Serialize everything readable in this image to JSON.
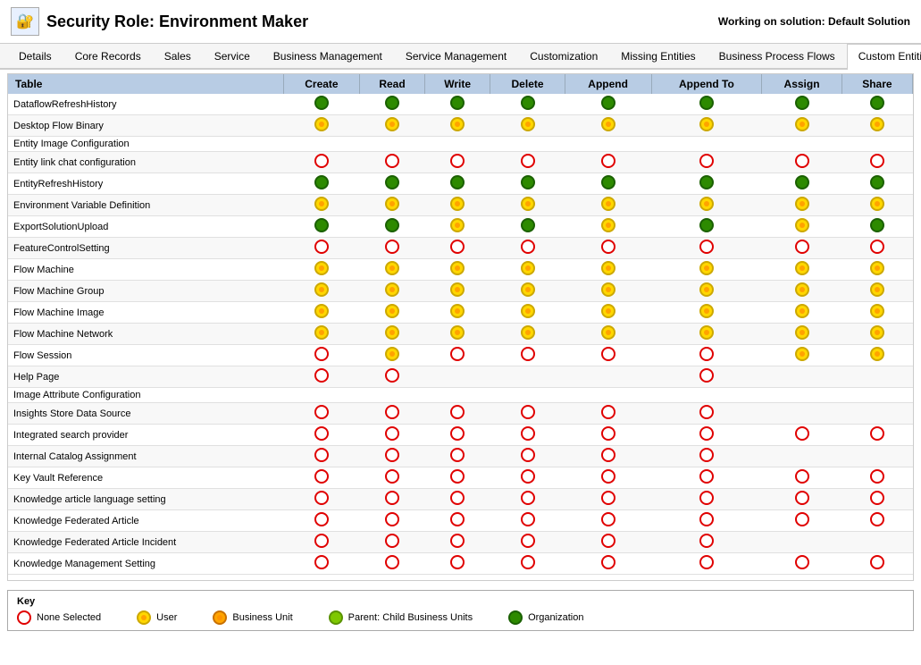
{
  "header": {
    "title": "Security Role: Environment Maker",
    "working_on": "Working on solution: Default Solution",
    "icon": "🔐"
  },
  "tabs": [
    {
      "label": "Details",
      "active": false
    },
    {
      "label": "Core Records",
      "active": false
    },
    {
      "label": "Sales",
      "active": false
    },
    {
      "label": "Service",
      "active": false
    },
    {
      "label": "Business Management",
      "active": false
    },
    {
      "label": "Service Management",
      "active": false
    },
    {
      "label": "Customization",
      "active": false
    },
    {
      "label": "Missing Entities",
      "active": false
    },
    {
      "label": "Business Process Flows",
      "active": false
    },
    {
      "label": "Custom Entities",
      "active": true
    }
  ],
  "table": {
    "columns": [
      "Table",
      "Create",
      "Read",
      "Write",
      "Delete",
      "Append",
      "Append To",
      "Assign",
      "Share"
    ],
    "rows": [
      {
        "name": "DataflowRefreshHistory",
        "create": "green",
        "read": "green",
        "write": "green",
        "delete": "green",
        "append": "green",
        "appendTo": "green",
        "assign": "green",
        "share": "green"
      },
      {
        "name": "Desktop Flow Binary",
        "create": "yellow",
        "read": "yellow",
        "write": "yellow",
        "delete": "yellow",
        "append": "yellow",
        "appendTo": "yellow",
        "assign": "yellow",
        "share": "yellow"
      },
      {
        "name": "Entity Image Configuration",
        "create": "",
        "read": "",
        "write": "",
        "delete": "",
        "append": "",
        "appendTo": "",
        "assign": "",
        "share": ""
      },
      {
        "name": "Entity link chat configuration",
        "create": "red",
        "read": "red",
        "write": "red",
        "delete": "red",
        "append": "red",
        "appendTo": "red",
        "assign": "red",
        "share": "red"
      },
      {
        "name": "EntityRefreshHistory",
        "create": "green",
        "read": "green",
        "write": "green",
        "delete": "green",
        "append": "green",
        "appendTo": "green",
        "assign": "green",
        "share": "green"
      },
      {
        "name": "Environment Variable Definition",
        "create": "yellow",
        "read": "yellow",
        "write": "yellow",
        "delete": "yellow",
        "append": "yellow",
        "appendTo": "yellow",
        "assign": "yellow",
        "share": "yellow"
      },
      {
        "name": "ExportSolutionUpload",
        "create": "green",
        "read": "green",
        "write": "yellow",
        "delete": "green",
        "append": "yellow",
        "appendTo": "green",
        "assign": "yellow",
        "share": "green"
      },
      {
        "name": "FeatureControlSetting",
        "create": "red",
        "read": "red",
        "write": "red",
        "delete": "red",
        "append": "red",
        "appendTo": "red",
        "assign": "red",
        "share": "red"
      },
      {
        "name": "Flow Machine",
        "create": "yellow",
        "read": "yellow",
        "write": "yellow",
        "delete": "yellow",
        "append": "yellow",
        "appendTo": "yellow",
        "assign": "yellow",
        "share": "yellow"
      },
      {
        "name": "Flow Machine Group",
        "create": "yellow",
        "read": "yellow",
        "write": "yellow",
        "delete": "yellow",
        "append": "yellow",
        "appendTo": "yellow",
        "assign": "yellow",
        "share": "yellow"
      },
      {
        "name": "Flow Machine Image",
        "create": "yellow",
        "read": "yellow",
        "write": "yellow",
        "delete": "yellow",
        "append": "yellow",
        "appendTo": "yellow",
        "assign": "yellow",
        "share": "yellow"
      },
      {
        "name": "Flow Machine Network",
        "create": "yellow",
        "read": "yellow",
        "write": "yellow",
        "delete": "yellow",
        "append": "yellow",
        "appendTo": "yellow",
        "assign": "yellow",
        "share": "yellow"
      },
      {
        "name": "Flow Session",
        "create": "red",
        "read": "yellow",
        "write": "red",
        "delete": "red",
        "append": "red",
        "appendTo": "red",
        "assign": "yellow",
        "share": "yellow"
      },
      {
        "name": "Help Page",
        "create": "red",
        "read": "red",
        "write": "",
        "delete": "",
        "append": "",
        "appendTo": "red",
        "assign": "",
        "share": ""
      },
      {
        "name": "Image Attribute Configuration",
        "create": "",
        "read": "",
        "write": "",
        "delete": "",
        "append": "",
        "appendTo": "",
        "assign": "",
        "share": ""
      },
      {
        "name": "Insights Store Data Source",
        "create": "red",
        "read": "red",
        "write": "red",
        "delete": "red",
        "append": "red",
        "appendTo": "red",
        "assign": "",
        "share": ""
      },
      {
        "name": "Integrated search provider",
        "create": "red",
        "read": "red",
        "write": "red",
        "delete": "red",
        "append": "red",
        "appendTo": "red",
        "assign": "red",
        "share": "red"
      },
      {
        "name": "Internal Catalog Assignment",
        "create": "red",
        "read": "red",
        "write": "red",
        "delete": "red",
        "append": "red",
        "appendTo": "red",
        "assign": "",
        "share": ""
      },
      {
        "name": "Key Vault Reference",
        "create": "red",
        "read": "red",
        "write": "red",
        "delete": "red",
        "append": "red",
        "appendTo": "red",
        "assign": "red",
        "share": "red"
      },
      {
        "name": "Knowledge article language setting",
        "create": "red",
        "read": "red",
        "write": "red",
        "delete": "red",
        "append": "red",
        "appendTo": "red",
        "assign": "red",
        "share": "red"
      },
      {
        "name": "Knowledge Federated Article",
        "create": "red",
        "read": "red",
        "write": "red",
        "delete": "red",
        "append": "red",
        "appendTo": "red",
        "assign": "red",
        "share": "red"
      },
      {
        "name": "Knowledge Federated Article Incident",
        "create": "red",
        "read": "red",
        "write": "red",
        "delete": "red",
        "append": "red",
        "appendTo": "red",
        "assign": "",
        "share": ""
      },
      {
        "name": "Knowledge Management Setting",
        "create": "red",
        "read": "red",
        "write": "red",
        "delete": "red",
        "append": "red",
        "appendTo": "red",
        "assign": "red",
        "share": "red"
      }
    ]
  },
  "key": {
    "title": "Key",
    "items": [
      {
        "label": "None Selected",
        "type": "red"
      },
      {
        "label": "User",
        "type": "yellow"
      },
      {
        "label": "Business Unit",
        "type": "yellow-dark"
      },
      {
        "label": "Parent: Child Business Units",
        "type": "yellow-green"
      },
      {
        "label": "Organization",
        "type": "green"
      }
    ]
  }
}
